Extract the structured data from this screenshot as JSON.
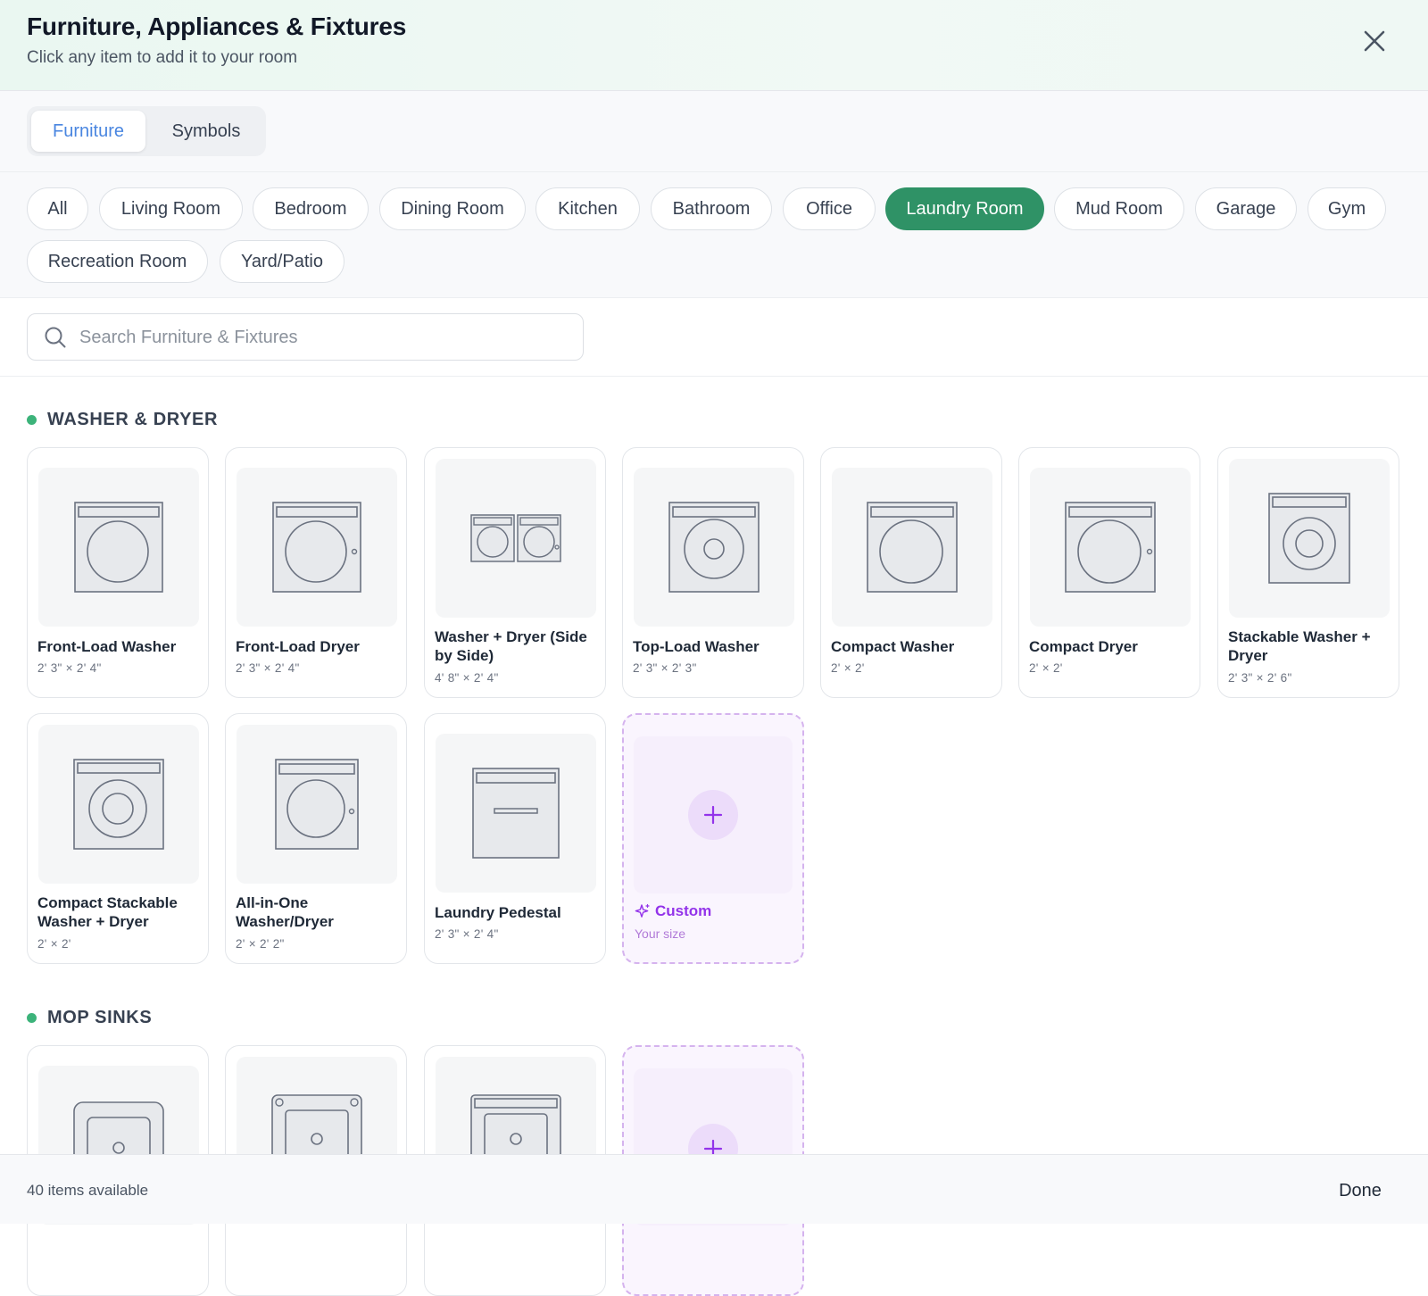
{
  "header": {
    "title": "Furniture, Appliances & Fixtures",
    "subtitle": "Click any item to add it to your room",
    "close_icon": "close-icon"
  },
  "tabs": [
    {
      "label": "Furniture",
      "active": true
    },
    {
      "label": "Symbols",
      "active": false
    }
  ],
  "categories": [
    {
      "label": "All"
    },
    {
      "label": "Living Room"
    },
    {
      "label": "Bedroom"
    },
    {
      "label": "Dining Room"
    },
    {
      "label": "Kitchen"
    },
    {
      "label": "Bathroom"
    },
    {
      "label": "Office"
    },
    {
      "label": "Laundry Room",
      "selected": true
    },
    {
      "label": "Mud Room"
    },
    {
      "label": "Garage"
    },
    {
      "label": "Gym"
    },
    {
      "label": "Recreation Room"
    },
    {
      "label": "Yard/Patio"
    }
  ],
  "search": {
    "placeholder": "Search Furniture & Fixtures",
    "value": "",
    "icon": "search-icon"
  },
  "sections": [
    {
      "title": "WASHER & DRYER",
      "items": [
        {
          "name": "Front-Load Washer",
          "size": "2' 3\" × 2' 4\"",
          "icon": "front-load-washer-icon"
        },
        {
          "name": "Front-Load Dryer",
          "size": "2' 3\" × 2' 4\"",
          "icon": "front-load-dryer-icon"
        },
        {
          "name": "Washer + Dryer (Side by Side)",
          "size": "4' 8\" × 2' 4\"",
          "icon": "washer-dryer-side-by-side-icon"
        },
        {
          "name": "Top-Load Washer",
          "size": "2' 3\" × 2' 3\"",
          "icon": "top-load-washer-icon"
        },
        {
          "name": "Compact Washer",
          "size": "2' × 2'",
          "icon": "compact-washer-icon"
        },
        {
          "name": "Compact Dryer",
          "size": "2' × 2'",
          "icon": "compact-dryer-icon"
        },
        {
          "name": "Stackable Washer + Dryer",
          "size": "2' 3\" × 2' 6\"",
          "icon": "stackable-washer-dryer-icon"
        },
        {
          "name": "Compact Stackable Washer + Dryer",
          "size": "2' × 2'",
          "icon": "compact-stackable-washer-dryer-icon"
        },
        {
          "name": "All-in-One Washer/Dryer",
          "size": "2' × 2' 2\"",
          "icon": "all-in-one-washer-dryer-icon"
        },
        {
          "name": "Laundry Pedestal",
          "size": "2' 3\" × 2' 4\"",
          "icon": "laundry-pedestal-icon"
        }
      ],
      "custom": {
        "label": "Custom",
        "sub": "Your size",
        "icon": "sparkle-icon"
      }
    },
    {
      "title": "MOP SINKS",
      "items": [
        {
          "icon": "mop-sink-icon"
        },
        {
          "icon": "mop-sink-icon"
        },
        {
          "icon": "mop-sink-icon"
        }
      ],
      "custom": {
        "icon": "plus-icon"
      }
    }
  ],
  "footer": {
    "count": "40 items available",
    "done": "Done"
  },
  "colors": {
    "accent_green": "#2f9266",
    "tab_active_blue": "#4a86e0",
    "custom_purple": "#9333ea"
  }
}
